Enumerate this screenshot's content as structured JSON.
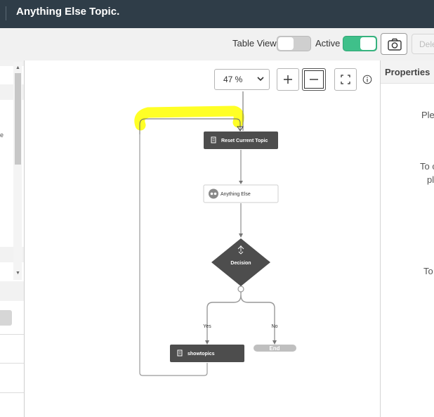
{
  "header": {
    "title": "Anything Else Topic."
  },
  "toolbar": {
    "table_view_label": "Table View",
    "table_view_on": false,
    "active_label": "Active",
    "active_on": true,
    "delete_label": "Dele"
  },
  "left_panel": {
    "snippet": "e"
  },
  "canvas": {
    "zoom_value": "47 %",
    "nodes": {
      "reset": "Reset Current Topic",
      "anything_else": "Anything Else",
      "decision": "Decision",
      "show_topics": "showtopics",
      "end": "End"
    },
    "edges": {
      "yes": "Yes",
      "no": "No"
    }
  },
  "properties": {
    "title": "Properties",
    "line1": "Ple",
    "line2": "To c",
    "line3": "pl",
    "line4": "To"
  },
  "colors": {
    "header_bg": "#2f3d48",
    "toggle_on": "#3fc08a",
    "node_dark": "#4d4d4d",
    "end_node": "#bfbfbf",
    "highlight": "#ffff00"
  }
}
